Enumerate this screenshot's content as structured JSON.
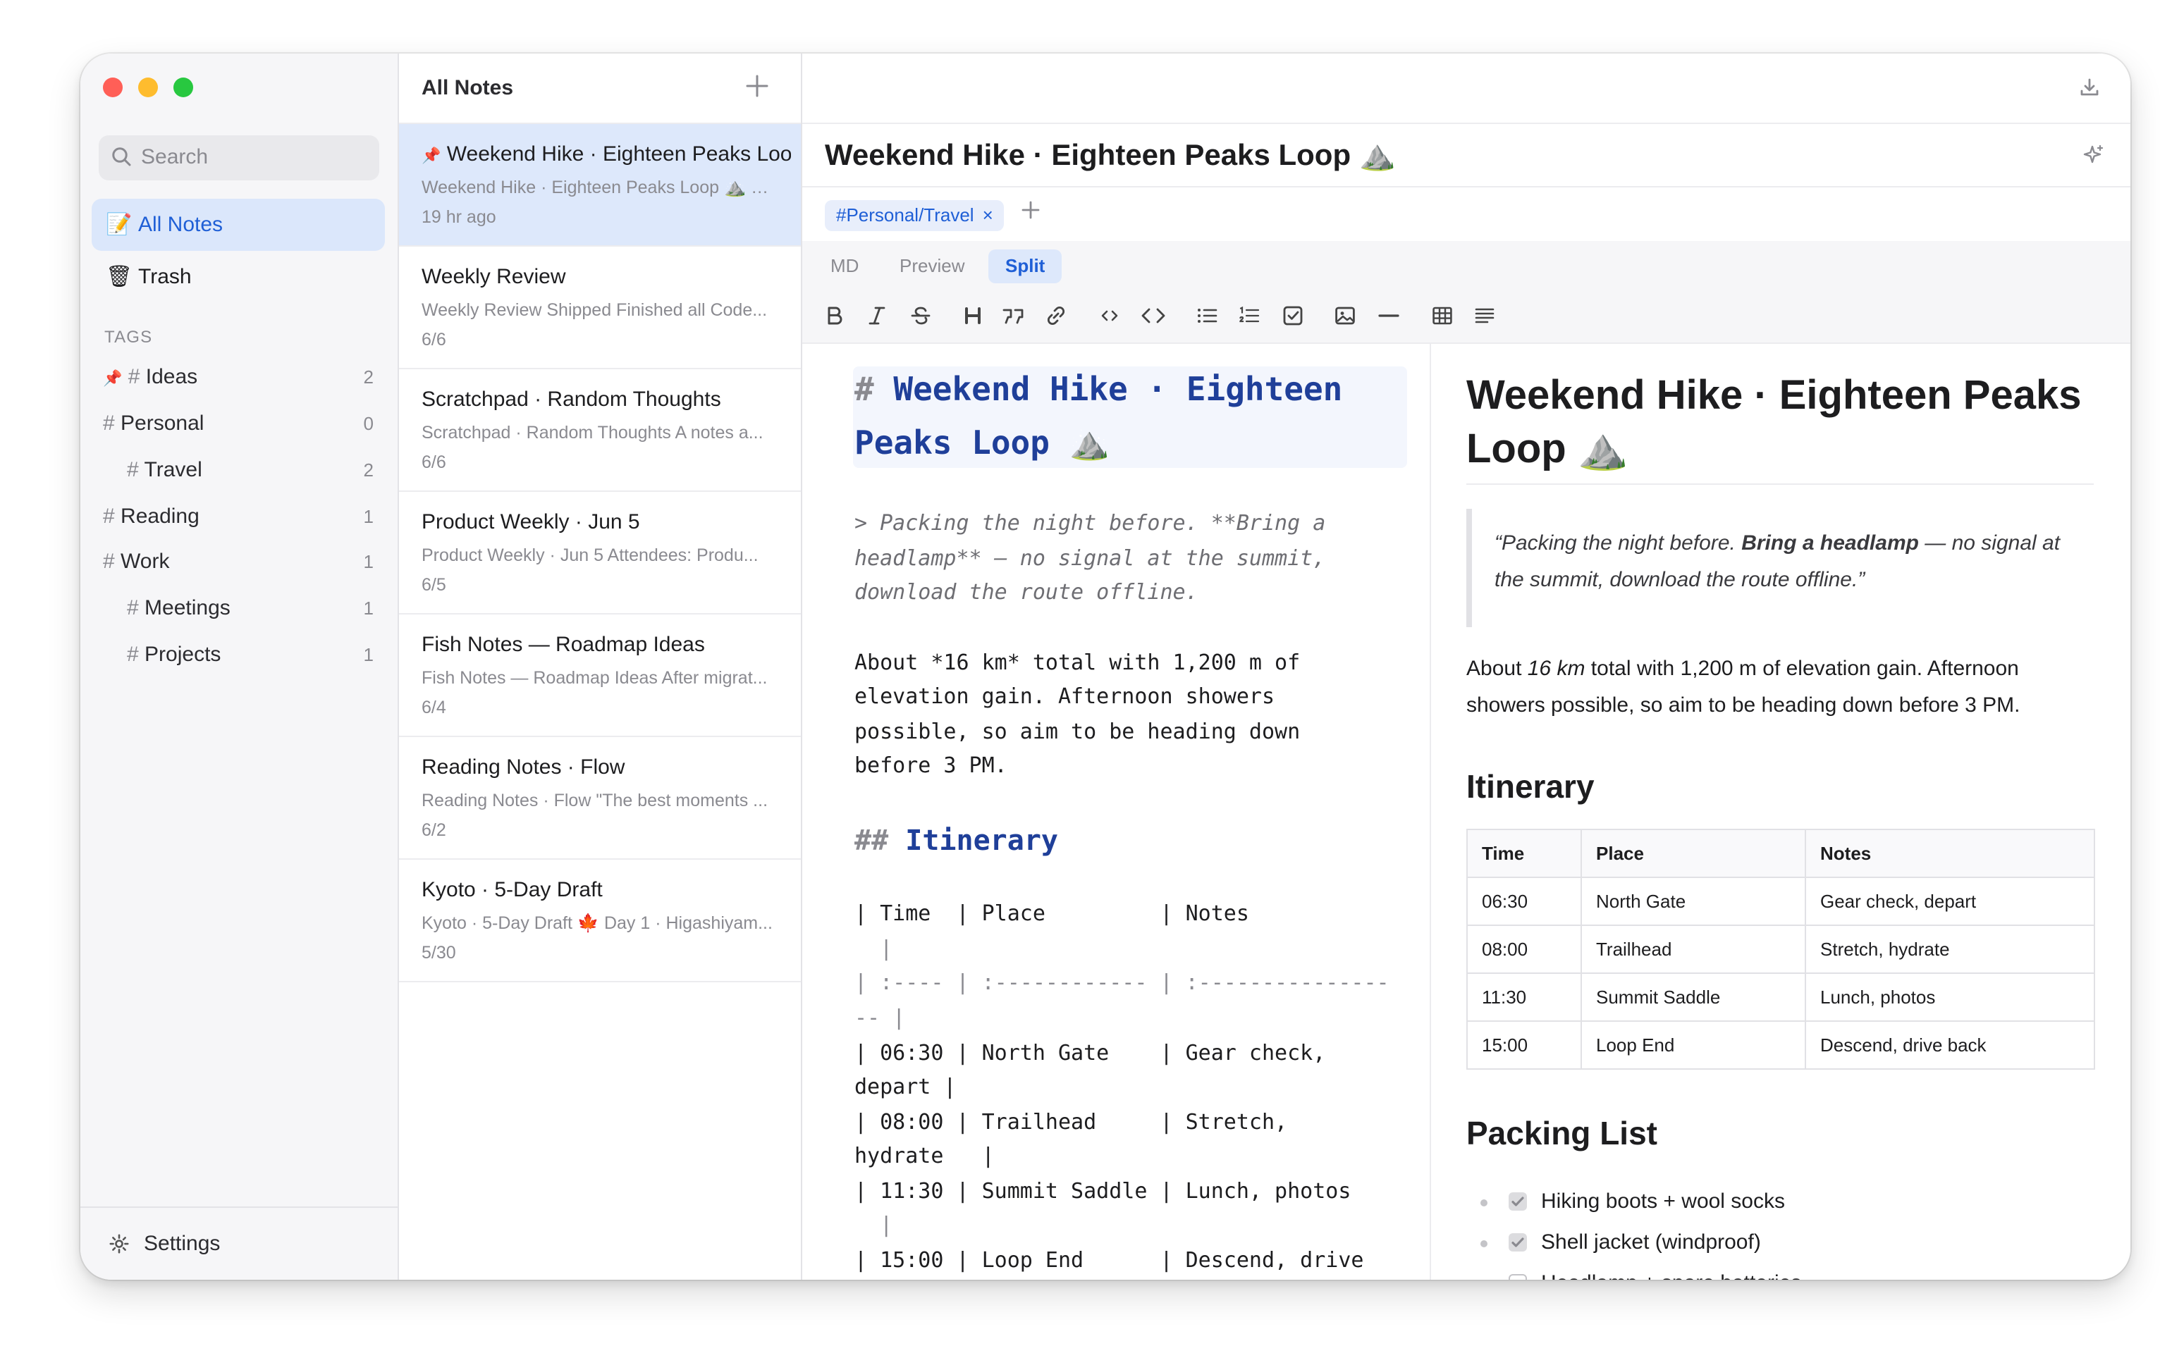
{
  "window": {
    "traffic_lights": [
      "#ff5f57",
      "#febc2e",
      "#28c840"
    ]
  },
  "sidebar": {
    "search_placeholder": "Search",
    "nav": [
      {
        "emoji": "📝",
        "label": "All Notes",
        "active": true
      },
      {
        "emoji": "🗑",
        "label": "Trash",
        "active": false
      }
    ],
    "tags_heading": "TAGS",
    "tags": [
      {
        "name": "Ideas",
        "count": "2",
        "pinned": true
      },
      {
        "name": "Personal",
        "count": "0"
      },
      {
        "name": "Travel",
        "count": "2"
      },
      {
        "name": "Reading",
        "count": "1"
      },
      {
        "name": "Work",
        "count": "1"
      },
      {
        "name": "Meetings",
        "count": "1"
      },
      {
        "name": "Projects",
        "count": "1"
      }
    ],
    "settings_label": "Settings"
  },
  "notes_list": {
    "title": "All Notes",
    "notes": [
      {
        "title": "Weekend Hike · Eighteen Peaks Loop",
        "preview": "Weekend Hike · Eighteen Peaks Loop ⛰️ Packing the night before.",
        "date": "19 hr ago",
        "pinned": true
      },
      {
        "title": "Weekly Review",
        "preview": "Weekly Review Shipped Finished all Code...",
        "date": "6/6"
      },
      {
        "title": "Scratchpad · Random Thoughts",
        "preview": "Scratchpad · Random Thoughts A notes a...",
        "date": "6/6"
      },
      {
        "title": "Product Weekly · Jun 5",
        "preview": "Product Weekly · Jun 5 Attendees: Produ...",
        "date": "6/5"
      },
      {
        "title": "Fish Notes — Roadmap Ideas",
        "preview": "Fish Notes — Roadmap Ideas After migrat...",
        "date": "6/4"
      },
      {
        "title": "Reading Notes · Flow",
        "preview": "Reading Notes · Flow \"The best moments ...",
        "date": "6/2"
      },
      {
        "title": "Kyoto · 5-Day Draft",
        "preview": "Kyoto · 5-Day Draft 🍁 Day 1 · Higashiyam...",
        "date": "5/30"
      }
    ]
  },
  "editor": {
    "title": "Weekend Hike · Eighteen Peaks Loop ⛰️",
    "tag_chip": "#Personal/Travel",
    "tag_remove": "×",
    "modes": [
      "MD",
      "Preview",
      "Split"
    ],
    "active_mode": "Split",
    "toolbar_icons": [
      "bold-icon",
      "italic-icon",
      "strikethrough-icon",
      "heading-icon",
      "quote-icon",
      "link-icon",
      "inline-code-icon",
      "code-block-icon",
      "bullet-list-icon",
      "numbered-list-icon",
      "checkbox-icon",
      "image-icon",
      "horizontal-rule-icon",
      "table-icon",
      "align-icon"
    ],
    "source_lines": {
      "h1_a": "Weekend Hike · Eighteen",
      "h1_b": "Peaks Loop ⛰️",
      "q1": "> Packing the night before. **Bring a",
      "q2": "headlamp** — no signal at the summit,",
      "q3": "download the route offline.",
      "p1": "About *16 km* total with 1,200 m of",
      "p2": "elevation gain. Afternoon showers",
      "p3": "possible, so aim to be heading down",
      "p4": "before 3 PM.",
      "h2": "Itinerary",
      "t1": "| Time  | Place         | Notes",
      "t1b": "  |",
      "t2": "| :---- | :------------ | :---------------",
      "t2b": "-- |",
      "t3": "| 06:30 | North Gate    | Gear check,",
      "t3b": "depart |",
      "t4": "| 08:00 | Trailhead     | Stretch,",
      "t4b": "hydrate   |",
      "t5": "| 11:30 | Summit Saddle | Lunch, photos",
      "t5b": "  |",
      "t6": "| 15:00 | Loop End      | Descend, drive"
    }
  },
  "preview": {
    "title": "Weekend Hike · Eighteen Peaks Loop ⛰️",
    "quote_a": "“Packing the night before. ",
    "quote_b": "Bring a headlamp",
    "quote_c": " — no signal at the summit, download the route offline.”",
    "para_a": "About ",
    "para_b": "16 km",
    "para_c": " total with 1,200 m of elevation gain. Afternoon showers possible, so aim to be heading down before 3 PM.",
    "itinerary_heading": "Itinerary",
    "table_headers": [
      "Time",
      "Place",
      "Notes"
    ],
    "table_rows": [
      [
        "06:30",
        "North Gate",
        "Gear check, depart"
      ],
      [
        "08:00",
        "Trailhead",
        "Stretch, hydrate"
      ],
      [
        "11:30",
        "Summit Saddle",
        "Lunch, photos"
      ],
      [
        "15:00",
        "Loop End",
        "Descend, drive back"
      ]
    ],
    "packing_heading": "Packing List",
    "packing": [
      {
        "label": "Hiking boots + wool socks",
        "checked": true
      },
      {
        "label": "Shell jacket (windproof)",
        "checked": true
      },
      {
        "label": "Headlamp + spare batteries",
        "checked": false
      }
    ]
  }
}
